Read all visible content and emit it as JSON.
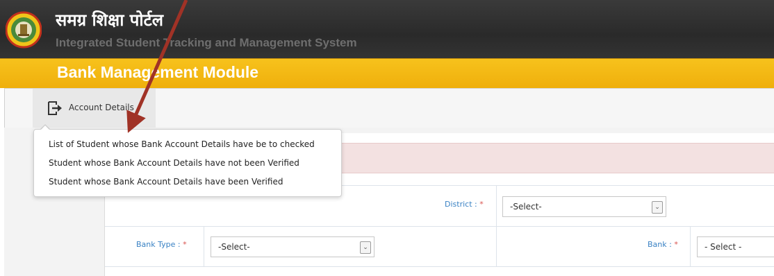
{
  "header": {
    "title_hindi": "समग्र शिक्षा पोर्टल",
    "subtitle": "Integrated Student Tracking and Management System"
  },
  "module": {
    "title": "Bank Management Module"
  },
  "menu": {
    "items": [
      {
        "label": "Account Details",
        "icon": "export-icon"
      }
    ]
  },
  "dropdown": {
    "items": [
      {
        "label": "List of Student whose Bank Account Details have be to checked"
      },
      {
        "label": "Student whose Bank Account Details have not been Verified"
      },
      {
        "label": "Student whose Bank Account Details have been Verified"
      }
    ]
  },
  "form": {
    "district": {
      "label": "District :",
      "required_mark": "*",
      "value": "-Select-"
    },
    "bank_type": {
      "label": "Bank Type :",
      "required_mark": "*",
      "value": "-Select-"
    },
    "bank": {
      "label": "Bank :",
      "required_mark": "*",
      "value": "- Select -"
    }
  },
  "colors": {
    "header_bg": "#2e2e2e",
    "module_bar": "#f5b914",
    "label_blue": "#3a82c4",
    "required_red": "#d9534f",
    "alert_band": "#f3e1e1",
    "annotation_arrow": "#a03226"
  }
}
